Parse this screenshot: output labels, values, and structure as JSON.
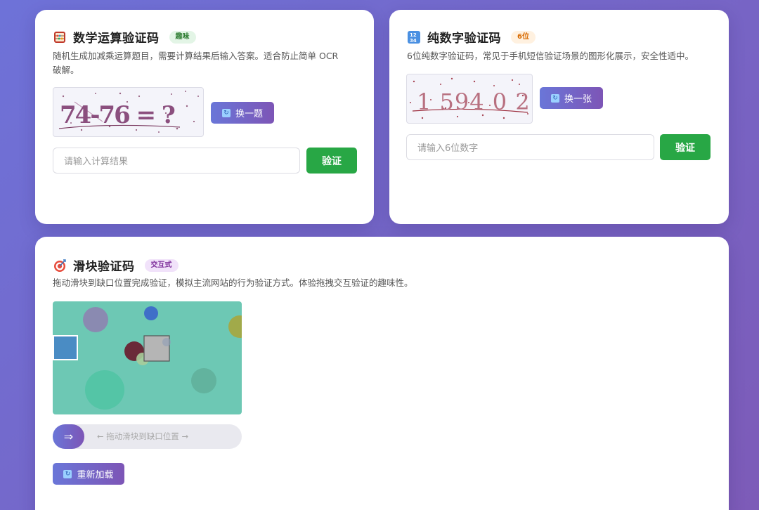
{
  "math_card": {
    "title": "数学运算验证码",
    "badge": "趣味",
    "desc_line1": "随机生成加减乘运算题目，需要计算结果后输入答案。适合防止简单 OCR",
    "desc_line2": "破解。",
    "captcha_text": "74-76 = ?",
    "refresh_label": "换一题",
    "input_placeholder": "请输入计算结果",
    "verify_label": "验证",
    "icon": "abacus-icon"
  },
  "digit_card": {
    "title": "纯数字验证码",
    "badge": "6位",
    "desc": "6位纯数字验证码，常见于手机短信验证场景的图形化展示，安全性适中。",
    "captcha_text": "1 594 0 2",
    "refresh_label": "换一张",
    "input_placeholder": "请输入6位数字",
    "verify_label": "验证",
    "icon": "numbers-icon"
  },
  "slider_card": {
    "title": "滑块验证码",
    "badge": "交互式",
    "desc": "拖动滑块到缺口位置完成验证，模拟主流网站的行为验证方式。体验拖拽交互验证的趣味性。",
    "slider_hint": "← 拖动滑块到缺口位置 →",
    "handle_symbol": "⇒",
    "reload_label": "重新加载",
    "icon": "target-icon"
  },
  "colors": {
    "verify_green": "#28a745",
    "accent_purple": "#7d55b6",
    "puzzle_bg": "#6dc8b4"
  }
}
